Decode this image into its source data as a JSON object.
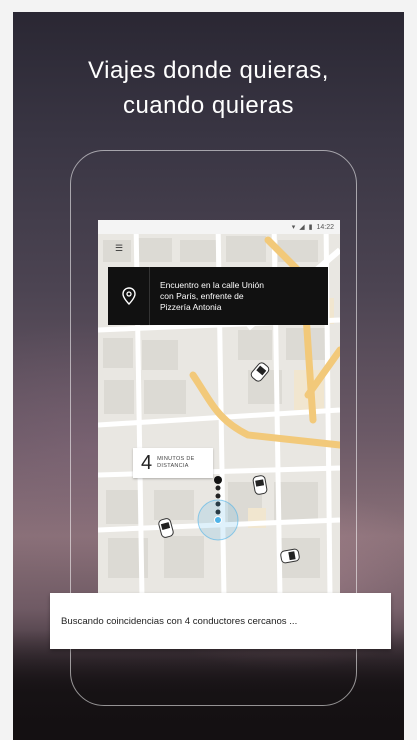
{
  "headline": {
    "line1": "Viajes donde quieras,",
    "line2": "cuando quieras"
  },
  "status_bar": {
    "time": "14:22"
  },
  "pickup": {
    "line1": "Encuentro en la calle Unión",
    "line2": "con París, enfrente de",
    "line3": "Pizzería Antonia",
    "icon": "location-pin-icon"
  },
  "eta": {
    "value": "4",
    "unit_line1": "MINUTOS DE",
    "unit_line2": "DISTANCIA"
  },
  "search": {
    "status_text": "Buscando coincidencias con 4 conductores cercanos ..."
  },
  "colors": {
    "route": "#f2c97a",
    "pickup_card": "#111111",
    "location_dot": "#4fb3e8"
  }
}
